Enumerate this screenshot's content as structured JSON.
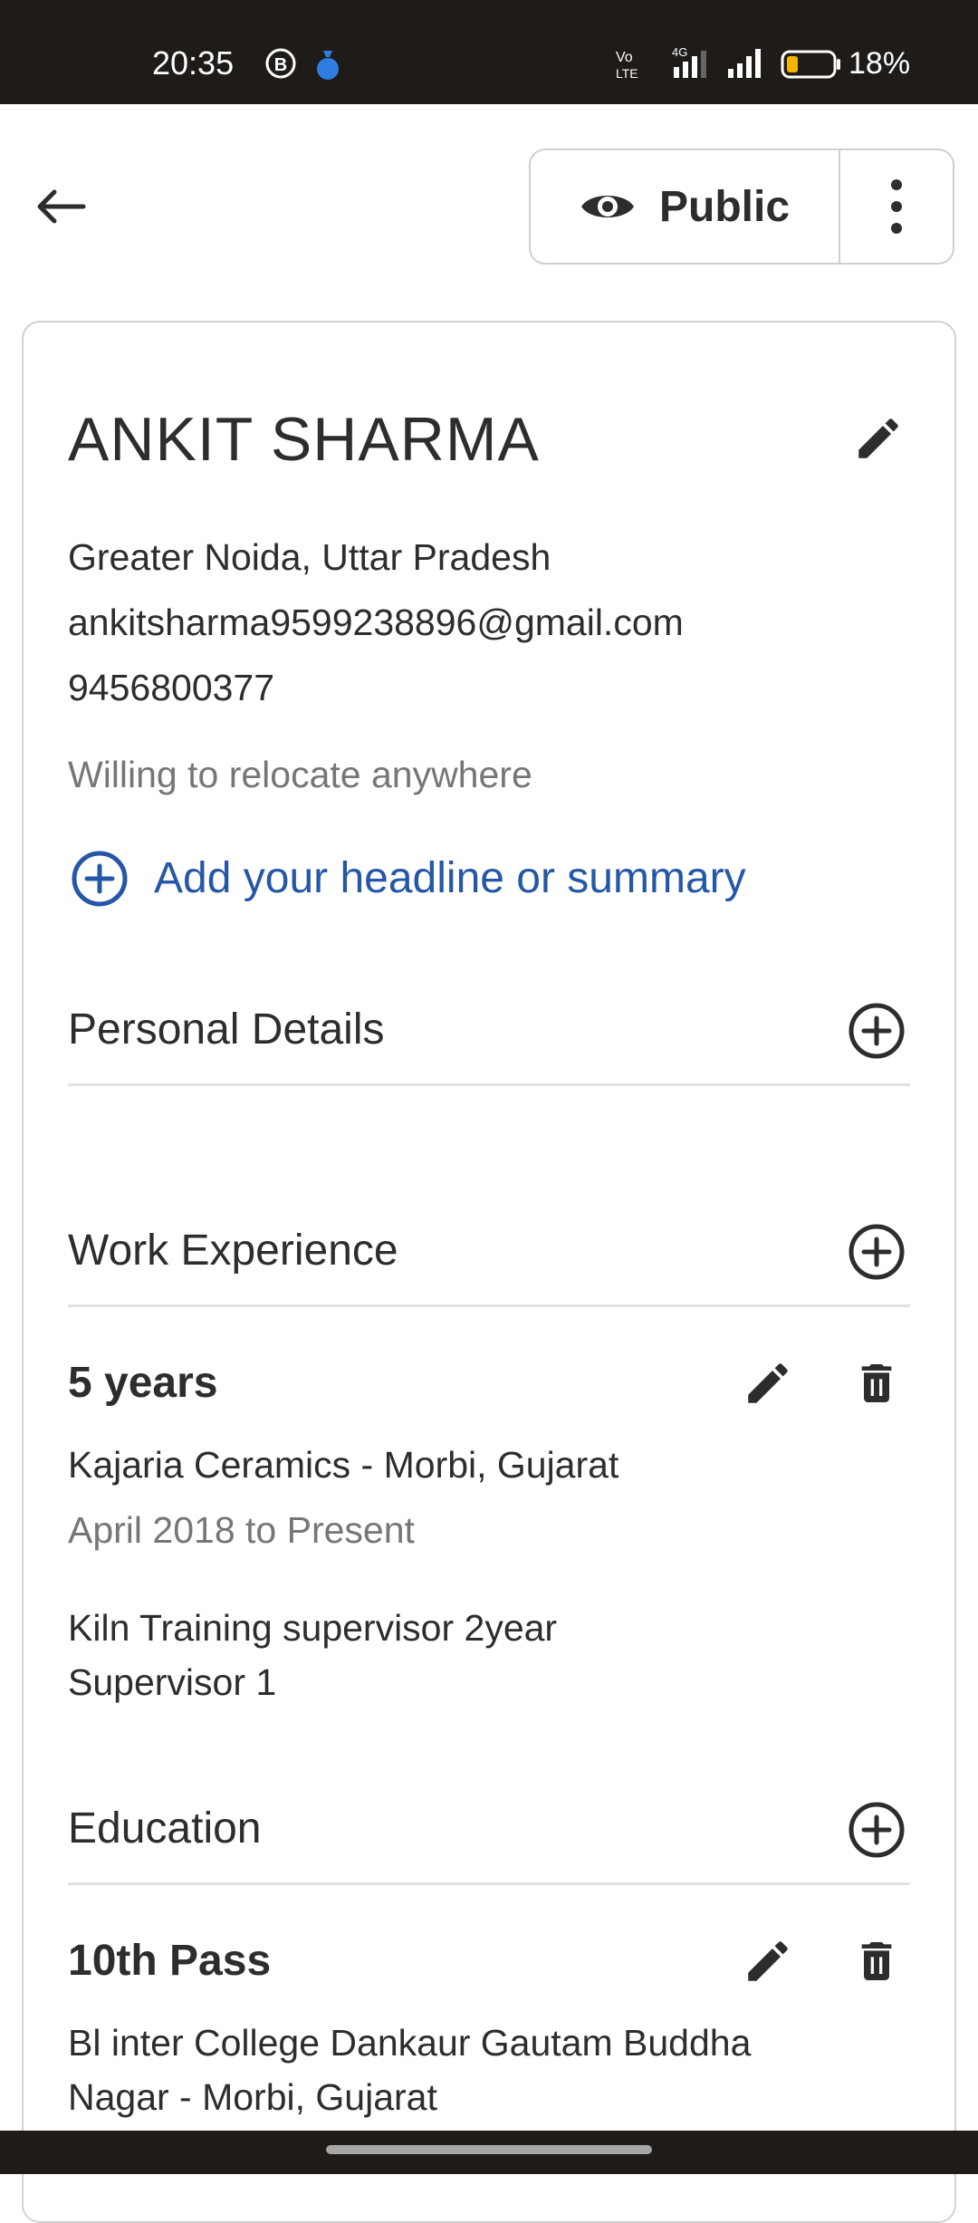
{
  "status_bar": {
    "time": "20:35",
    "battery_percent": "18%",
    "network_label": "4G",
    "volte_label": "Vo LTE"
  },
  "header": {
    "visibility_label": "Public"
  },
  "profile": {
    "name": "ANKIT SHARMA",
    "location": "Greater Noida, Uttar Pradesh",
    "email": "ankitsharma9599238896@gmail.com",
    "phone": "9456800377",
    "relocation": "Willing to relocate anywhere",
    "add_headline_label": "Add your headline or summary"
  },
  "sections": {
    "personal_details": {
      "title": "Personal Details"
    },
    "work_experience": {
      "title": "Work Experience",
      "entry": {
        "title": "5 years",
        "company": "Kajaria Ceramics - Morbi, Gujarat",
        "dates": "April 2018 to Present",
        "description_line1": "Kiln Training supervisor 2year",
        "description_line2": "Supervisor 1"
      }
    },
    "education": {
      "title": "Education",
      "entry": {
        "title": "10th Pass",
        "school_line1": "Bl inter College Dankaur Gautam Buddha",
        "school_line2": "Nagar - Morbi, Gujarat"
      }
    }
  },
  "colors": {
    "accent_blue": "#2557a7",
    "text_primary": "#2d2d2d",
    "text_muted": "#767676",
    "status_bar_bg": "#1e1b18",
    "battery_low": "#f5b400"
  }
}
